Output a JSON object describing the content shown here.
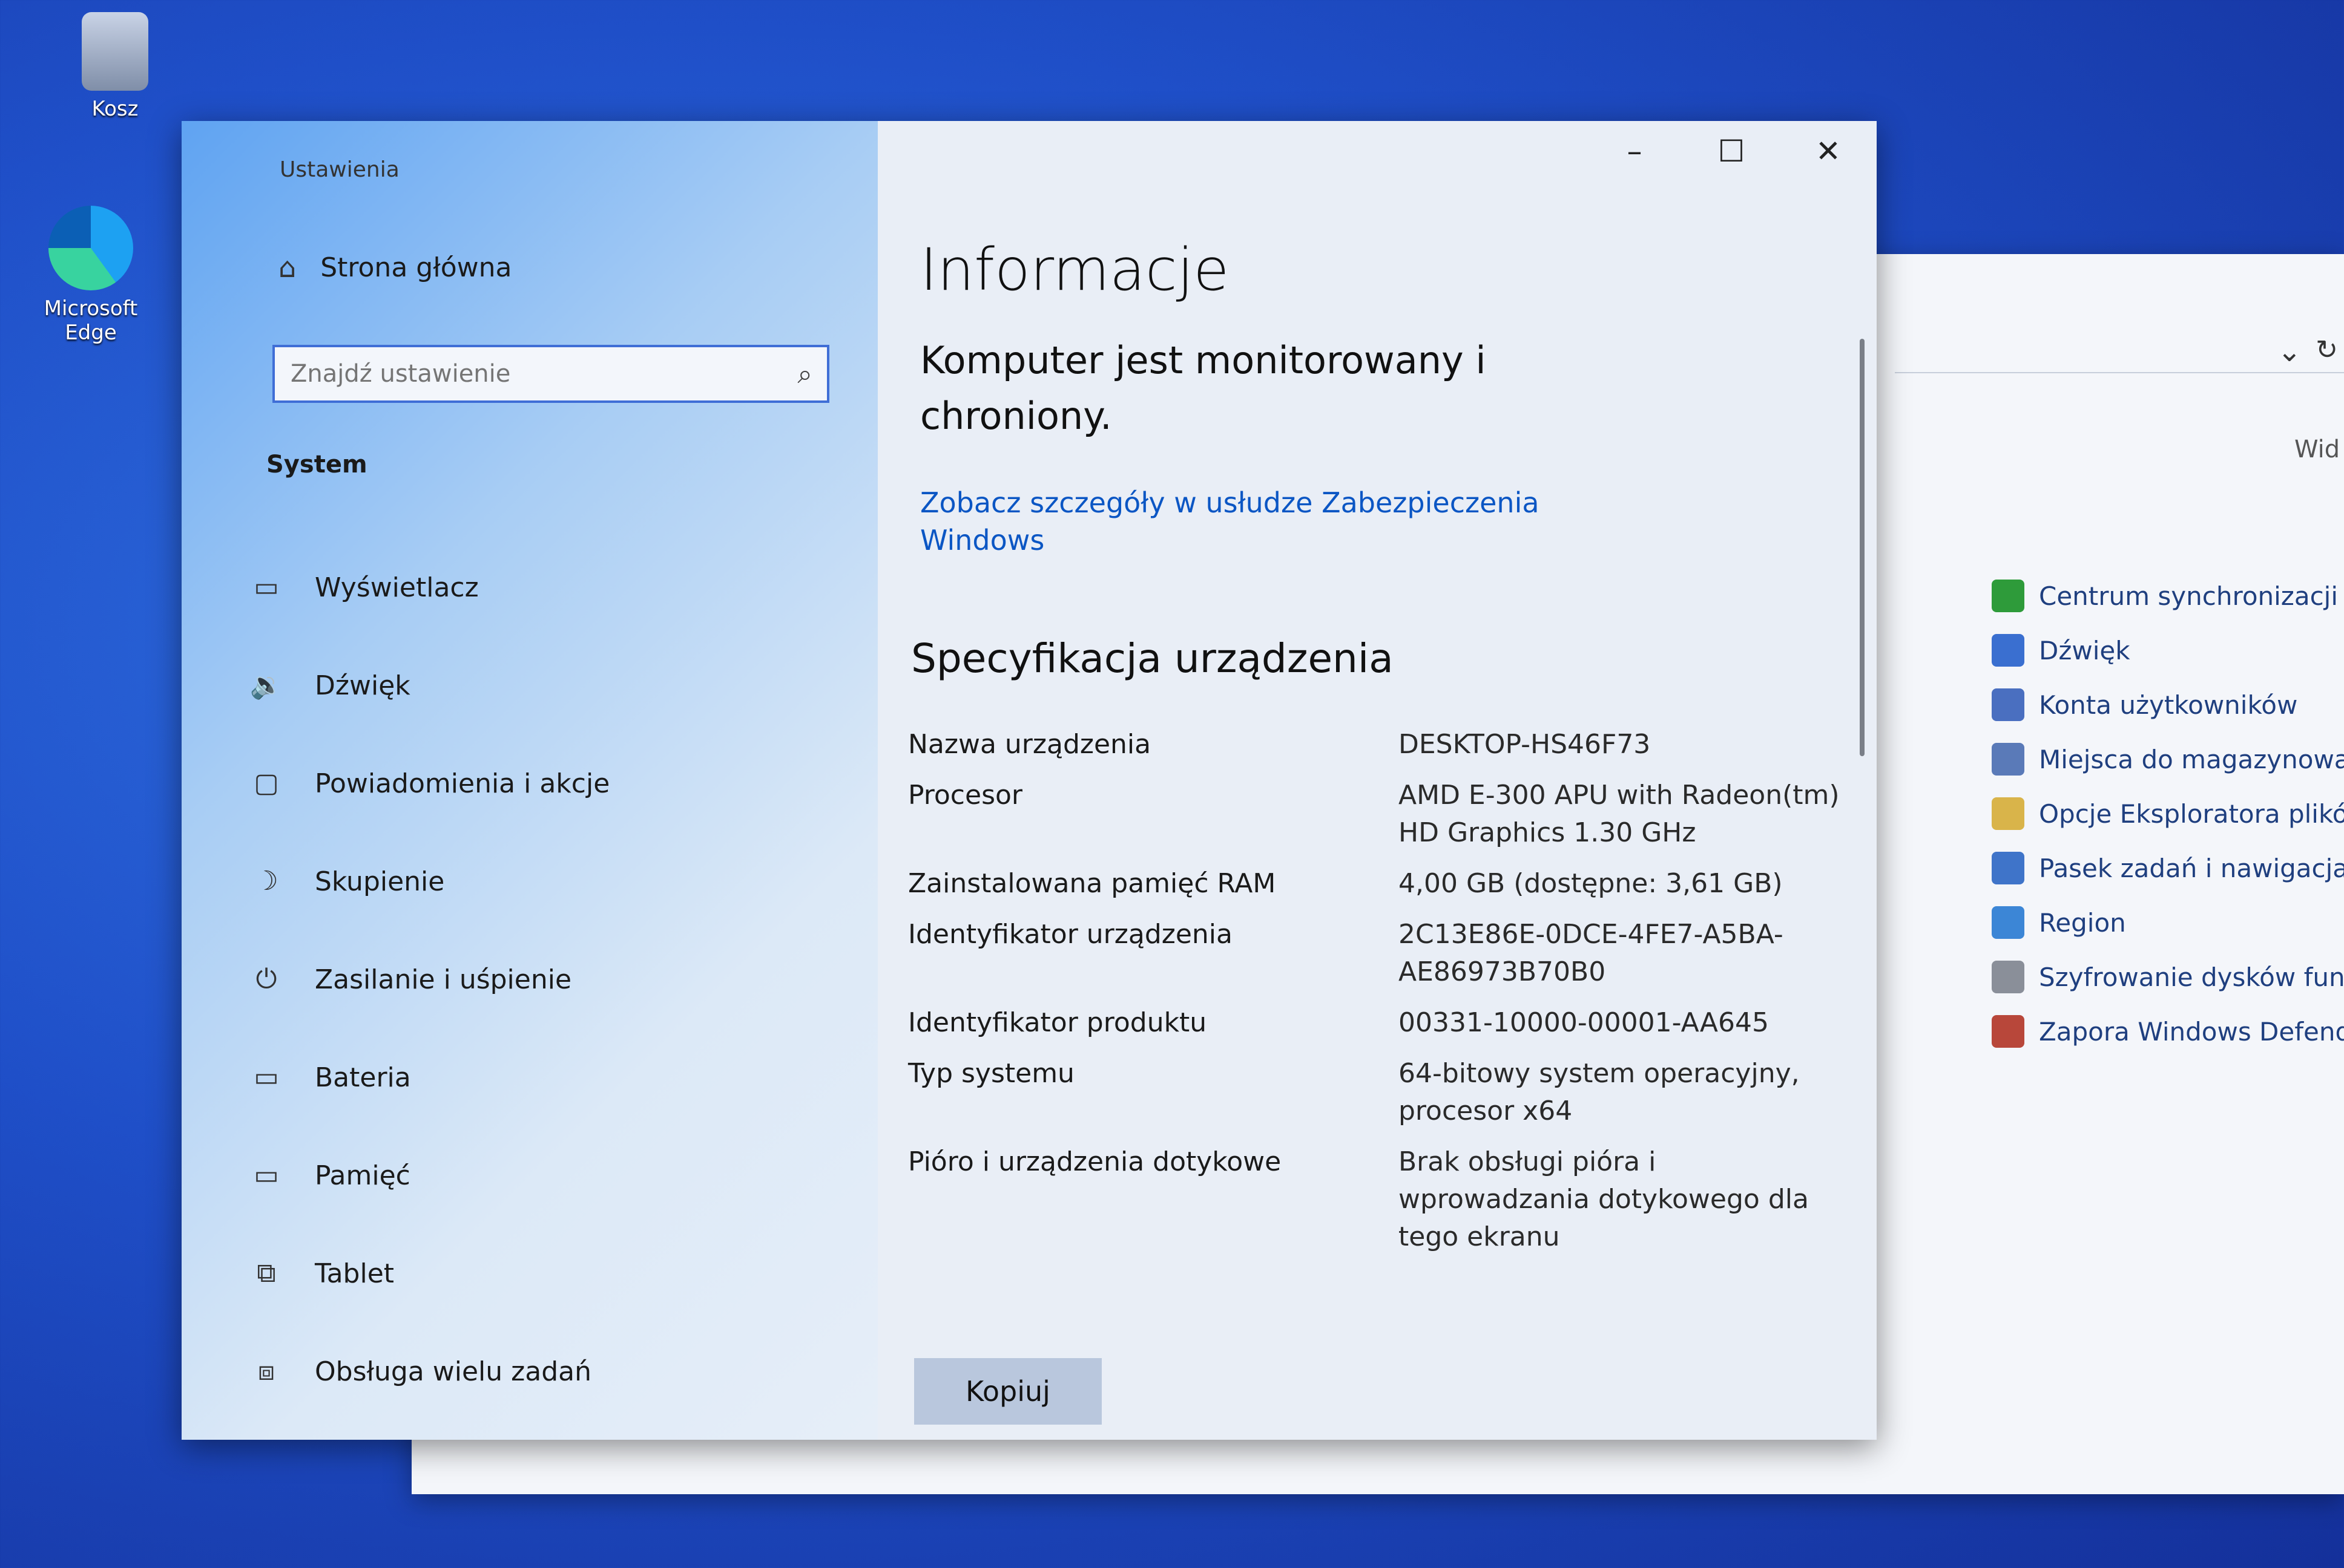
{
  "desktop": {
    "icons": [
      {
        "label": "Kosz",
        "icon": "recycle-bin-icon"
      },
      {
        "label": "Microsoft Edge",
        "icon": "edge-icon"
      }
    ]
  },
  "background_window": {
    "view_label": "Wid",
    "items": [
      {
        "label": "Centrum synchronizacji",
        "icon": "sync-center-icon",
        "color": "#2e9b3a"
      },
      {
        "label": "Dźwięk",
        "icon": "speaker-icon",
        "color": "#3a6fd0"
      },
      {
        "label": "Konta użytkowników",
        "icon": "user-accounts-icon",
        "color": "#4a6fc0"
      },
      {
        "label": "Miejsca do magazynowan",
        "icon": "storage-spaces-icon",
        "color": "#5a7ab8"
      },
      {
        "label": "Opcje Eksploratora plików",
        "icon": "folder-options-icon",
        "color": "#d9b44a"
      },
      {
        "label": "Pasek zadań i nawigacja",
        "icon": "taskbar-icon",
        "color": "#3f74c9"
      },
      {
        "label": "Region",
        "icon": "region-globe-icon",
        "color": "#3c86d6"
      },
      {
        "label": "Szyfrowanie dysków funkc",
        "icon": "bitlocker-icon",
        "color": "#8a8f99"
      },
      {
        "label": "Zapora Windows Defende",
        "icon": "firewall-icon",
        "color": "#b8473a"
      }
    ]
  },
  "settings": {
    "app_title": "Ustawienia",
    "home_label": "Strona główna",
    "search": {
      "placeholder": "Znajdź ustawienie"
    },
    "section_label": "System",
    "nav": [
      {
        "label": "Wyświetlacz",
        "icon": "display-icon",
        "glyph": "▭"
      },
      {
        "label": "Dźwięk",
        "icon": "sound-icon",
        "glyph": "🔉"
      },
      {
        "label": "Powiadomienia i akcje",
        "icon": "notifications-icon",
        "glyph": "▢"
      },
      {
        "label": "Skupienie",
        "icon": "focus-moon-icon",
        "glyph": "☽"
      },
      {
        "label": "Zasilanie i uśpienie",
        "icon": "power-icon",
        "glyph": "⏻"
      },
      {
        "label": "Bateria",
        "icon": "battery-icon",
        "glyph": "▭"
      },
      {
        "label": "Pamięć",
        "icon": "storage-icon",
        "glyph": "▭"
      },
      {
        "label": "Tablet",
        "icon": "tablet-icon",
        "glyph": "⧉"
      },
      {
        "label": "Obsługa wielu zadań",
        "icon": "multitasking-icon",
        "glyph": "⧈"
      }
    ],
    "page_title": "Informacje",
    "status_text": "Komputer jest monitorowany i chroniony.",
    "security_link": "Zobacz szczegóły w usłudze Zabezpieczenia Windows",
    "spec_heading": "Specyfikacja urządzenia",
    "specs": [
      {
        "key": "Nazwa urządzenia",
        "value": "DESKTOP-HS46F73"
      },
      {
        "key": "Procesor",
        "value": "AMD E-300 APU with Radeon(tm) HD Graphics 1.30 GHz"
      },
      {
        "key": "Zainstalowana pamięć RAM",
        "value": "4,00 GB (dostępne: 3,61 GB)"
      },
      {
        "key": "Identyfikator urządzenia",
        "value": "2C13E86E-0DCE-4FE7-A5BA-AE86973B70B0"
      },
      {
        "key": "Identyfikator produktu",
        "value": "00331-10000-00001-AA645"
      },
      {
        "key": "Typ systemu",
        "value": "64-bitowy system operacyjny, procesor x64"
      },
      {
        "key": "Pióro i urządzenia dotykowe",
        "value": "Brak obsługi pióra i wprowadzania dotykowego dla tego ekranu"
      }
    ],
    "copy_label": "Kopiuj",
    "controls": {
      "minimize": "–",
      "maximize": "☐",
      "close": "✕"
    }
  }
}
